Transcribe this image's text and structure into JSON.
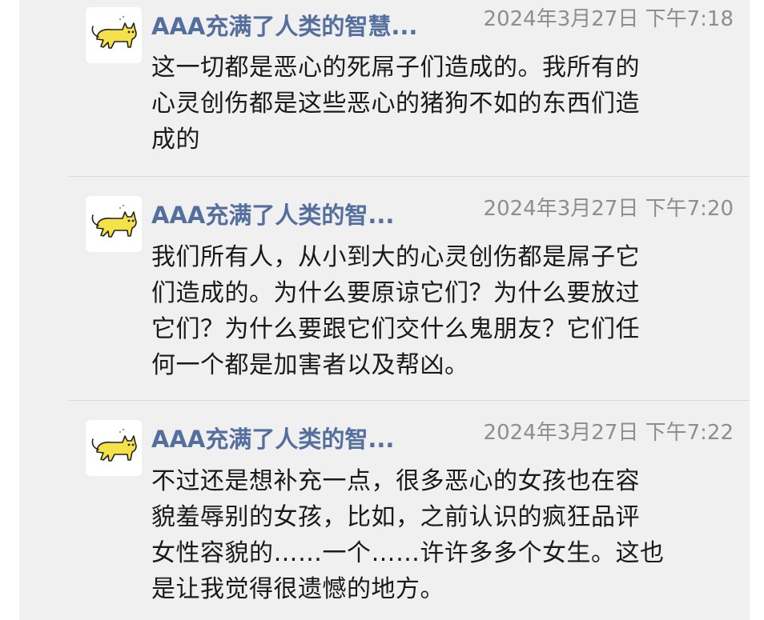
{
  "messages": [
    {
      "author": "AAA充满了人类的智慧...",
      "timestamp": "2024年3月27日 下午7:18",
      "lines": [
        "这一切都是恶心的死屌子们造成的。我所有的",
        "心灵创伤都是这些恶心的猪狗不如的东西们造",
        "成的"
      ]
    },
    {
      "author": "AAA充满了人类的智...",
      "timestamp": "2024年3月27日 下午7:20",
      "lines": [
        "我们所有人，从小到大的心灵创伤都是屌子它",
        "们造成的。为什么要原谅它们？为什么要放过",
        "它们？为什么要跟它们交什么鬼朋友？它们任",
        "何一个都是加害者以及帮凶。"
      ]
    },
    {
      "author": "AAA充满了人类的智...",
      "timestamp": "2024年3月27日 下午7:22",
      "lines": [
        "不过还是想补充一点，很多恶心的女孩也在容",
        "貌羞辱别的女孩，比如，之前认识的疯狂品评",
        "女性容貌的……一个……许许多多个女生。这也",
        "是让我觉得很遗憾的地方。"
      ]
    }
  ],
  "avatar_icon": "yellow-cat-icon",
  "colors": {
    "panel_bg": "#f0f0f0",
    "name": "#546e9e",
    "time": "#8e8e8e",
    "text": "#1a1a1a",
    "avatar_cat": "#f5e24a"
  }
}
